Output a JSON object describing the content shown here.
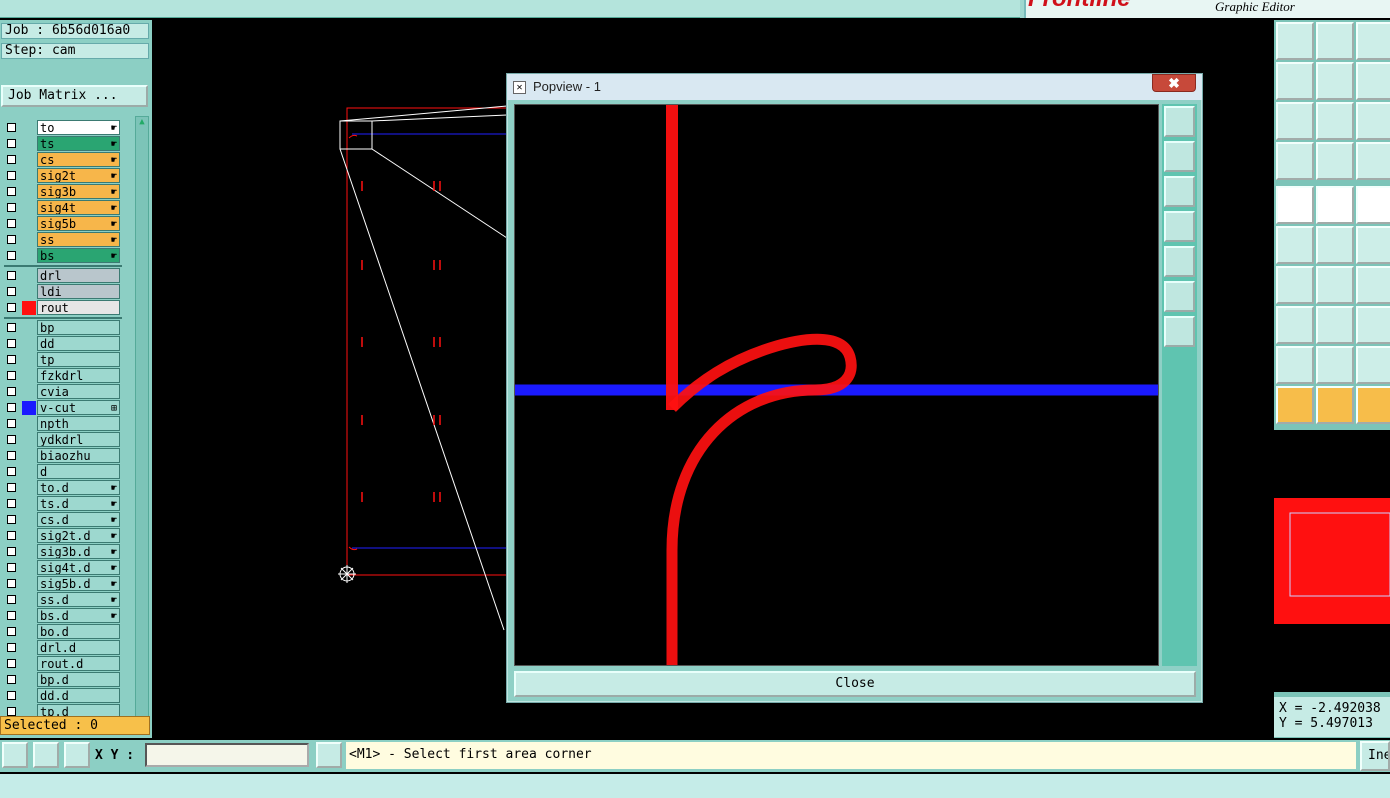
{
  "app": {
    "logo_text": "Frontline",
    "title": "Graphic Editor"
  },
  "job": {
    "job_line": "Job : 6b56d016a0",
    "step_line": "Step: cam",
    "matrix_button": "Job Matrix ..."
  },
  "layers": [
    {
      "name": "to",
      "color": "#ffffff",
      "mark": "☛",
      "swatch": ""
    },
    {
      "name": "ts",
      "color": "#2aa572",
      "mark": "☛",
      "swatch": ""
    },
    {
      "name": "cs",
      "color": "#f7b64a",
      "mark": "☛",
      "swatch": ""
    },
    {
      "name": "sig2t",
      "color": "#f7b64a",
      "mark": "☛",
      "swatch": ""
    },
    {
      "name": "sig3b",
      "color": "#f7b64a",
      "mark": "☛",
      "swatch": ""
    },
    {
      "name": "sig4t",
      "color": "#f7b64a",
      "mark": "☛",
      "swatch": ""
    },
    {
      "name": "sig5b",
      "color": "#f7b64a",
      "mark": "☛",
      "swatch": ""
    },
    {
      "name": "ss",
      "color": "#f7b64a",
      "mark": "☛",
      "swatch": ""
    },
    {
      "name": "bs",
      "color": "#2aa572",
      "mark": "☛",
      "swatch": ""
    },
    {
      "name": "drl",
      "color": "#b9c6cc",
      "mark": "",
      "swatch": "",
      "gap": true
    },
    {
      "name": "ldi",
      "color": "#b9c6cc",
      "mark": "",
      "swatch": ""
    },
    {
      "name": "rout",
      "color": "#e6e6e6",
      "mark": "",
      "swatch": "#ff1010"
    },
    {
      "name": "bp",
      "color": "#9dd8cf",
      "mark": "",
      "swatch": "",
      "gap": true
    },
    {
      "name": "dd",
      "color": "#9dd8cf",
      "mark": "",
      "swatch": ""
    },
    {
      "name": "tp",
      "color": "#9dd8cf",
      "mark": "",
      "swatch": ""
    },
    {
      "name": "fzkdrl",
      "color": "#9dd8cf",
      "mark": "",
      "swatch": ""
    },
    {
      "name": "cvia",
      "color": "#9dd8cf",
      "mark": "",
      "swatch": ""
    },
    {
      "name": "v-cut",
      "color": "#9dd8cf",
      "mark": "⊞",
      "swatch": "#1a1aff",
      "checked": true
    },
    {
      "name": "npth",
      "color": "#9dd8cf",
      "mark": "",
      "swatch": ""
    },
    {
      "name": "ydkdrl",
      "color": "#9dd8cf",
      "mark": "",
      "swatch": ""
    },
    {
      "name": "biaozhu",
      "color": "#9dd8cf",
      "mark": "",
      "swatch": ""
    },
    {
      "name": "d",
      "color": "#9dd8cf",
      "mark": "",
      "swatch": ""
    },
    {
      "name": "to.d",
      "color": "#9dd8cf",
      "mark": "☛",
      "swatch": ""
    },
    {
      "name": "ts.d",
      "color": "#9dd8cf",
      "mark": "☛",
      "swatch": ""
    },
    {
      "name": "cs.d",
      "color": "#9dd8cf",
      "mark": "☛",
      "swatch": ""
    },
    {
      "name": "sig2t.d",
      "color": "#9dd8cf",
      "mark": "☛",
      "swatch": ""
    },
    {
      "name": "sig3b.d",
      "color": "#9dd8cf",
      "mark": "☛",
      "swatch": ""
    },
    {
      "name": "sig4t.d",
      "color": "#9dd8cf",
      "mark": "☛",
      "swatch": ""
    },
    {
      "name": "sig5b.d",
      "color": "#9dd8cf",
      "mark": "☛",
      "swatch": ""
    },
    {
      "name": "ss.d",
      "color": "#9dd8cf",
      "mark": "☛",
      "swatch": ""
    },
    {
      "name": "bs.d",
      "color": "#9dd8cf",
      "mark": "☛",
      "swatch": ""
    },
    {
      "name": "bo.d",
      "color": "#9dd8cf",
      "mark": "",
      "swatch": ""
    },
    {
      "name": "drl.d",
      "color": "#9dd8cf",
      "mark": "",
      "swatch": ""
    },
    {
      "name": "rout.d",
      "color": "#9dd8cf",
      "mark": "",
      "swatch": ""
    },
    {
      "name": "bp.d",
      "color": "#9dd8cf",
      "mark": "",
      "swatch": ""
    },
    {
      "name": "dd.d",
      "color": "#9dd8cf",
      "mark": "",
      "swatch": ""
    },
    {
      "name": "tp.d",
      "color": "#9dd8cf",
      "mark": "",
      "swatch": ""
    }
  ],
  "selected": "Selected : 0",
  "popview": {
    "title": "Popview - 1",
    "close_label": "Close",
    "close_x": "✖"
  },
  "coords": {
    "x": "X = -2.492038",
    "y": "Y = 5.497013"
  },
  "bottom": {
    "xy_label": "X Y :",
    "xy_value": "",
    "message": "<M1> - Select first area corner",
    "ine_label": "Ine"
  },
  "colors": {
    "rout": "#ff1010",
    "vcut": "#1a1aff",
    "outline": "#ffffff"
  }
}
